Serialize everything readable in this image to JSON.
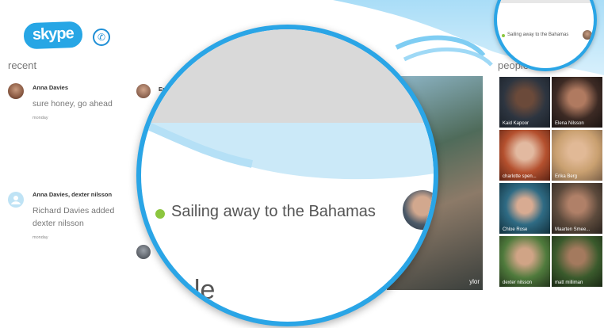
{
  "app": {
    "logo_text": "skype"
  },
  "sections": {
    "recent": "recent",
    "people": "people"
  },
  "recent": [
    {
      "name": "Anna Davies",
      "message": "sure honey, go ahead",
      "time": "monday"
    },
    {
      "name": "Anna Davies, dexter nilsson",
      "message": "Richard Davies added dexter nilsson",
      "time": "monday"
    }
  ],
  "second_col_name_fragment": "Er",
  "people_tiles": [
    {
      "name": "Kaid Kapoor"
    },
    {
      "name": "Elena Nilsson"
    },
    {
      "name": "charlotte spen..."
    },
    {
      "name": "Erika Berg"
    },
    {
      "name": "Chloe Rose"
    },
    {
      "name": "Maarten Smee..."
    },
    {
      "name": "dexter nilsson"
    },
    {
      "name": "matt milliman"
    }
  ],
  "feature_tile_label": "ylor",
  "mood_status": "Sailing away to the Bahamas",
  "magnified_heading_fragment": "ple",
  "colors": {
    "accent": "#2aa5e6",
    "status_online": "#8cc63f"
  }
}
